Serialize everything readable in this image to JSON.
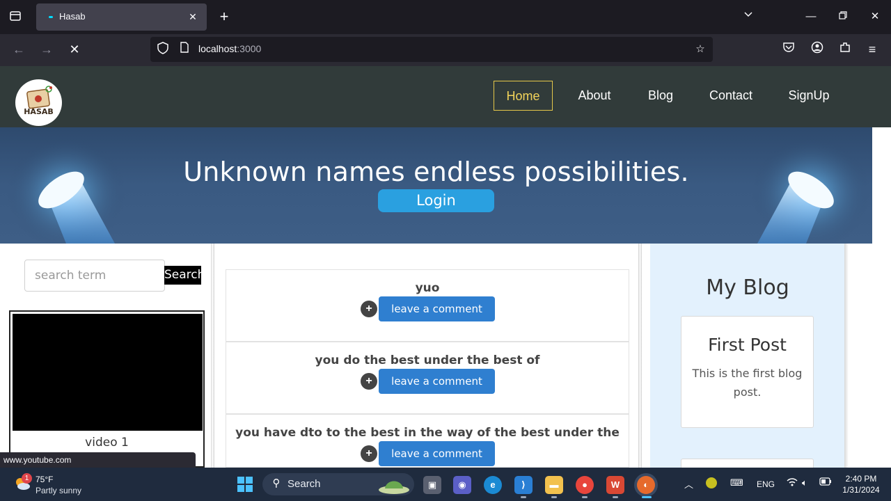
{
  "browser": {
    "tab_title": "Hasab",
    "url_host": "localhost",
    "url_port": ":3000",
    "status_url": "www.youtube.com"
  },
  "site": {
    "logo_text": "HASAB",
    "nav": [
      "Home",
      "About",
      "Blog",
      "Contact",
      "SignUp"
    ],
    "active_nav": "Home",
    "hero_title": "Unknown names endless possibilities.",
    "login_label": "Login",
    "search": {
      "placeholder": "search term",
      "button_label": "Search"
    },
    "videos": [
      {
        "label": "video 1"
      }
    ],
    "posts": [
      {
        "title": "yuo",
        "button_label": "leave a comment"
      },
      {
        "title": "you do the best under the best of",
        "button_label": "leave a comment"
      },
      {
        "title": "you have dto to the best in the way of the best under the study",
        "button_label": "leave a comment"
      }
    ],
    "blog": {
      "heading": "My Blog",
      "posts": [
        {
          "title": "First Post",
          "body": "This is the first blog post."
        },
        {
          "title": "",
          "body": ""
        }
      ]
    }
  },
  "taskbar": {
    "weather_temp": "75°F",
    "weather_desc": "Partly sunny",
    "weather_badge": "1",
    "search_label": "Search",
    "language": "ENG",
    "time": "2:40 PM",
    "date": "1/31/2024"
  },
  "colors": {
    "header_bg": "#313b3a",
    "active_nav": "#f2d35a",
    "login_btn": "#2aa0e0",
    "comment_btn": "#2f7fd0",
    "blog_panel": "#e3f1fd"
  }
}
